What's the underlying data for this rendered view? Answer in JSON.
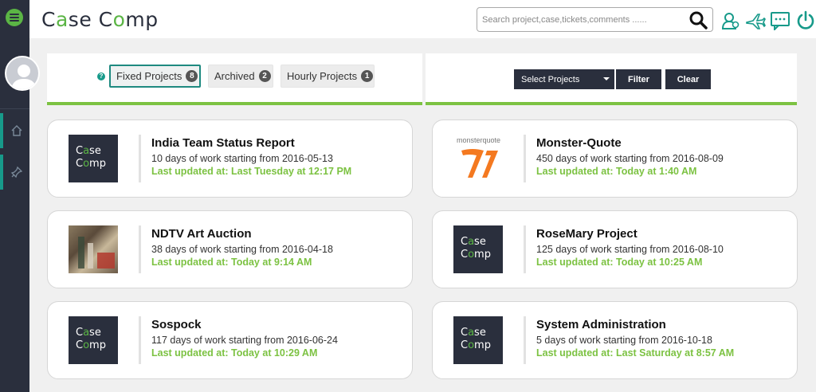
{
  "header": {
    "logo_text": "Case Comp",
    "search_placeholder": "Search project,case,tickets,comments ......"
  },
  "toolbar": {
    "tabs": [
      {
        "label": "Fixed Projects",
        "count": "8"
      },
      {
        "label": "Archived",
        "count": "2"
      },
      {
        "label": "Hourly Projects",
        "count": "1"
      }
    ],
    "help_glyph": "?",
    "select_label": "Select Projects",
    "filter_label": "Filter",
    "clear_label": "Clear"
  },
  "thumb_text": {
    "line1_a": "C",
    "line1_dot": "a",
    "line1_b": "se",
    "line2_a": "C",
    "line2_dot": "o",
    "line2_b": "mp"
  },
  "monster_logo_text": "monsterquote",
  "projects": [
    {
      "title": "India Team Status Report",
      "duration": "10 days of work starting from 2016-05-13",
      "updated": "Last updated at: Last Tuesday at 12:17 PM",
      "thumb": "casecomp"
    },
    {
      "title": "Monster-Quote",
      "duration": "450 days of work starting from 2016-08-09",
      "updated": "Last updated at: Today at 1:40 AM",
      "thumb": "monsterquote"
    },
    {
      "title": "NDTV Art Auction",
      "duration": "38 days of work starting from 2016-04-18",
      "updated": "Last updated at: Today at 9:14 AM",
      "thumb": "photo"
    },
    {
      "title": "RoseMary Project",
      "duration": "125 days of work starting from 2016-08-10",
      "updated": "Last updated at: Today at 10:25 AM",
      "thumb": "casecomp"
    },
    {
      "title": "Sospock",
      "duration": "117 days of work starting from 2016-06-24",
      "updated": "Last updated at: Today at 10:29 AM",
      "thumb": "casecomp"
    },
    {
      "title": "System Administration",
      "duration": "5 days of work starting from 2016-10-18",
      "updated": "Last updated at: Last Saturday at 8:57 AM",
      "thumb": "casecomp"
    }
  ],
  "colors": {
    "accent": "#7cc242",
    "teal": "#179a8a",
    "dark": "#2a2f3d"
  }
}
